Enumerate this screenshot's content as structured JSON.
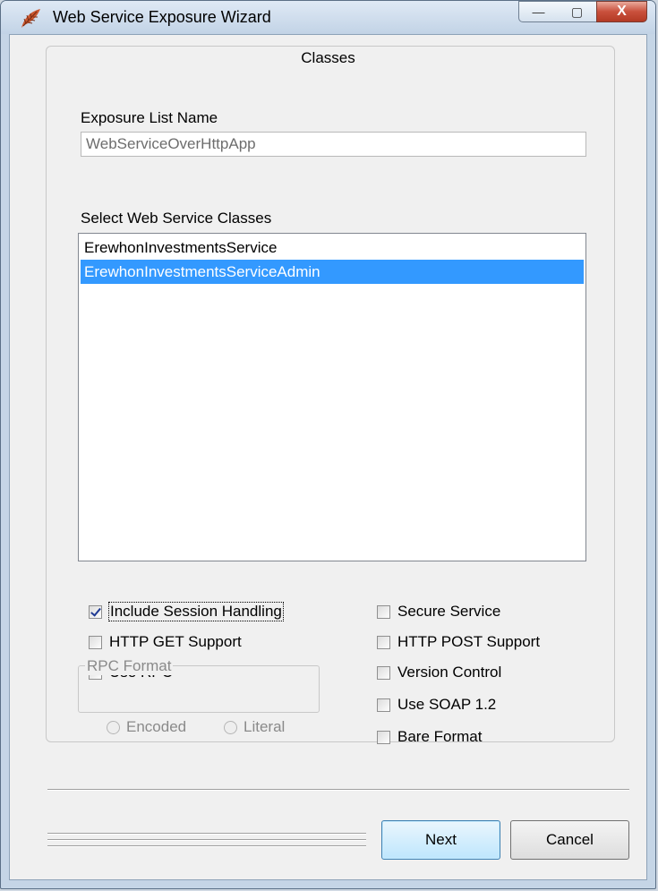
{
  "window": {
    "title": "Web Service Exposure Wizard",
    "controls": {
      "minimize": "—",
      "maximize": "▢",
      "close": "X"
    }
  },
  "section_title": "Classes",
  "exposure_list": {
    "label": "Exposure List Name",
    "value": "WebServiceOverHttpApp"
  },
  "classes": {
    "label": "Select Web Service Classes",
    "items": [
      {
        "label": "ErewhonInvestmentsService",
        "selected": false
      },
      {
        "label": "ErewhonInvestmentsServiceAdmin",
        "selected": true
      }
    ]
  },
  "options": {
    "include_session_handling": {
      "label": "Include Session Handling",
      "checked": true
    },
    "http_get_support": {
      "label": "HTTP GET Support",
      "checked": false
    },
    "use_rpc": {
      "label": "Use RPC",
      "checked": false
    },
    "secure_service": {
      "label": "Secure Service",
      "checked": false
    },
    "http_post_support": {
      "label": "HTTP POST Support",
      "checked": false
    },
    "version_control": {
      "label": "Version Control",
      "checked": false
    },
    "use_soap_12": {
      "label": "Use SOAP 1.2",
      "checked": false
    },
    "bare_format": {
      "label": "Bare Format",
      "checked": false
    }
  },
  "rpc_format": {
    "legend": "RPC Format",
    "encoded": "Encoded",
    "literal": "Literal",
    "enabled": false
  },
  "buttons": {
    "next": "Next",
    "cancel": "Cancel"
  },
  "colors": {
    "selection": "#3399ff",
    "check": "#1f3a93"
  }
}
